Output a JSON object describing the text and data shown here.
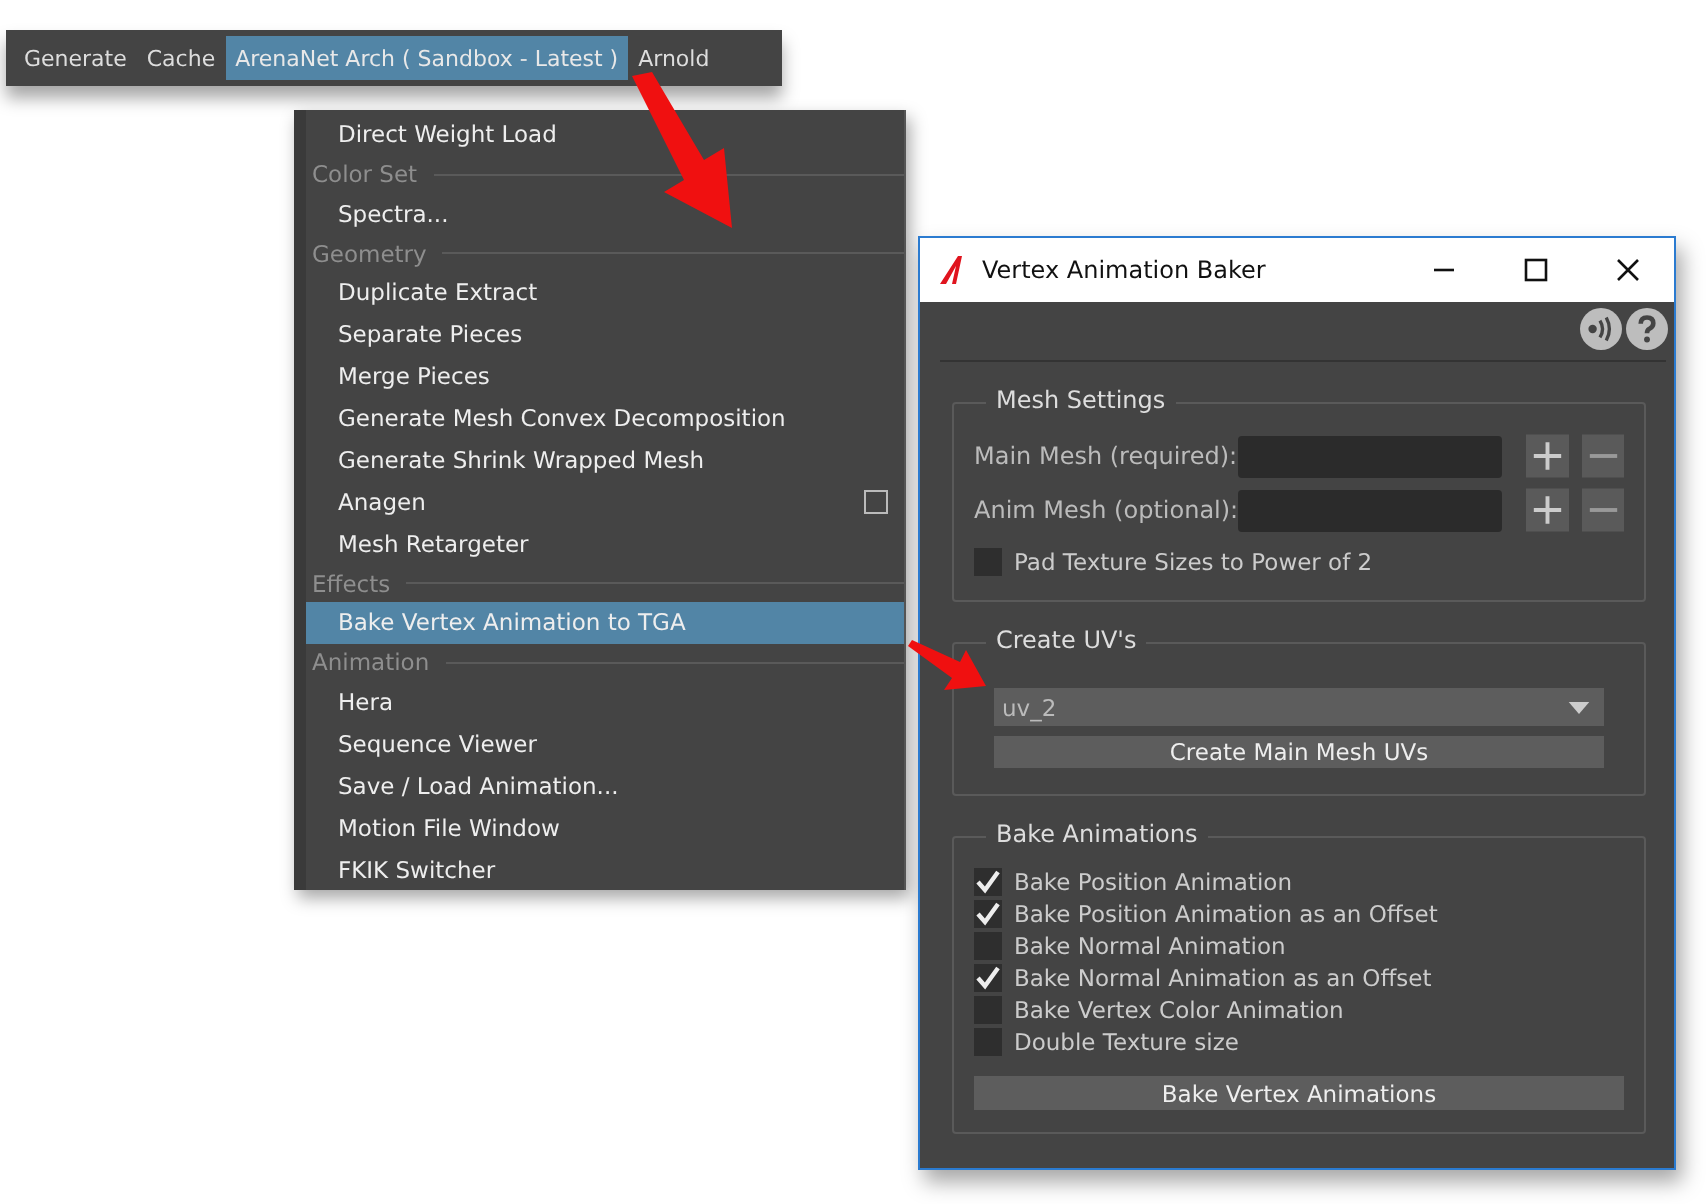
{
  "menubar": {
    "items": [
      {
        "label": "Generate",
        "selected": false
      },
      {
        "label": "Cache",
        "selected": false
      },
      {
        "label": "ArenaNet Arch ( Sandbox - Latest )",
        "selected": true
      },
      {
        "label": "Arnold",
        "selected": false
      }
    ]
  },
  "menu": {
    "items": [
      {
        "kind": "item",
        "label": "Direct Weight Load",
        "selected": false,
        "option_box": false
      },
      {
        "kind": "header",
        "label": "Color Set"
      },
      {
        "kind": "item",
        "label": "Spectra...",
        "selected": false,
        "option_box": false
      },
      {
        "kind": "header",
        "label": "Geometry"
      },
      {
        "kind": "item",
        "label": "Duplicate Extract",
        "selected": false,
        "option_box": false
      },
      {
        "kind": "item",
        "label": "Separate Pieces",
        "selected": false,
        "option_box": false
      },
      {
        "kind": "item",
        "label": "Merge Pieces",
        "selected": false,
        "option_box": false
      },
      {
        "kind": "item",
        "label": "Generate Mesh Convex Decomposition",
        "selected": false,
        "option_box": false
      },
      {
        "kind": "item",
        "label": "Generate Shrink Wrapped Mesh",
        "selected": false,
        "option_box": false
      },
      {
        "kind": "item",
        "label": "Anagen",
        "selected": false,
        "option_box": true
      },
      {
        "kind": "item",
        "label": "Mesh Retargeter",
        "selected": false,
        "option_box": false
      },
      {
        "kind": "header",
        "label": "Effects"
      },
      {
        "kind": "item",
        "label": "Bake Vertex Animation to TGA",
        "selected": true,
        "option_box": false
      },
      {
        "kind": "header",
        "label": "Animation"
      },
      {
        "kind": "item",
        "label": "Hera",
        "selected": false,
        "option_box": false
      },
      {
        "kind": "item",
        "label": "Sequence Viewer",
        "selected": false,
        "option_box": false
      },
      {
        "kind": "item",
        "label": "Save / Load Animation...",
        "selected": false,
        "option_box": false
      },
      {
        "kind": "item",
        "label": "Motion File Window",
        "selected": false,
        "option_box": false
      },
      {
        "kind": "item",
        "label": "FKIK Switcher",
        "selected": false,
        "option_box": false
      }
    ]
  },
  "window": {
    "title": "Vertex Animation Baker",
    "mesh_settings": {
      "title": "Mesh Settings",
      "fields": [
        {
          "label": "Main Mesh (required):"
        },
        {
          "label": "Anim Mesh (optional):"
        }
      ],
      "checkbox": {
        "label": "Pad Texture Sizes to Power of 2",
        "checked": false
      }
    },
    "create_uvs": {
      "title": "Create UV's",
      "dropdown": "uv_2",
      "button": "Create Main Mesh UVs"
    },
    "bake_animations": {
      "title": "Bake Animations",
      "options": [
        {
          "label": "Bake Position Animation",
          "checked": true
        },
        {
          "label": "Bake Position Animation as an Offset",
          "checked": true
        },
        {
          "label": "Bake Normal Animation",
          "checked": false
        },
        {
          "label": "Bake Normal Animation as an Offset",
          "checked": true
        },
        {
          "label": "Bake Vertex Color Animation",
          "checked": false
        },
        {
          "label": "Double Texture size",
          "checked": false
        }
      ],
      "button": "Bake Vertex Animations"
    }
  }
}
